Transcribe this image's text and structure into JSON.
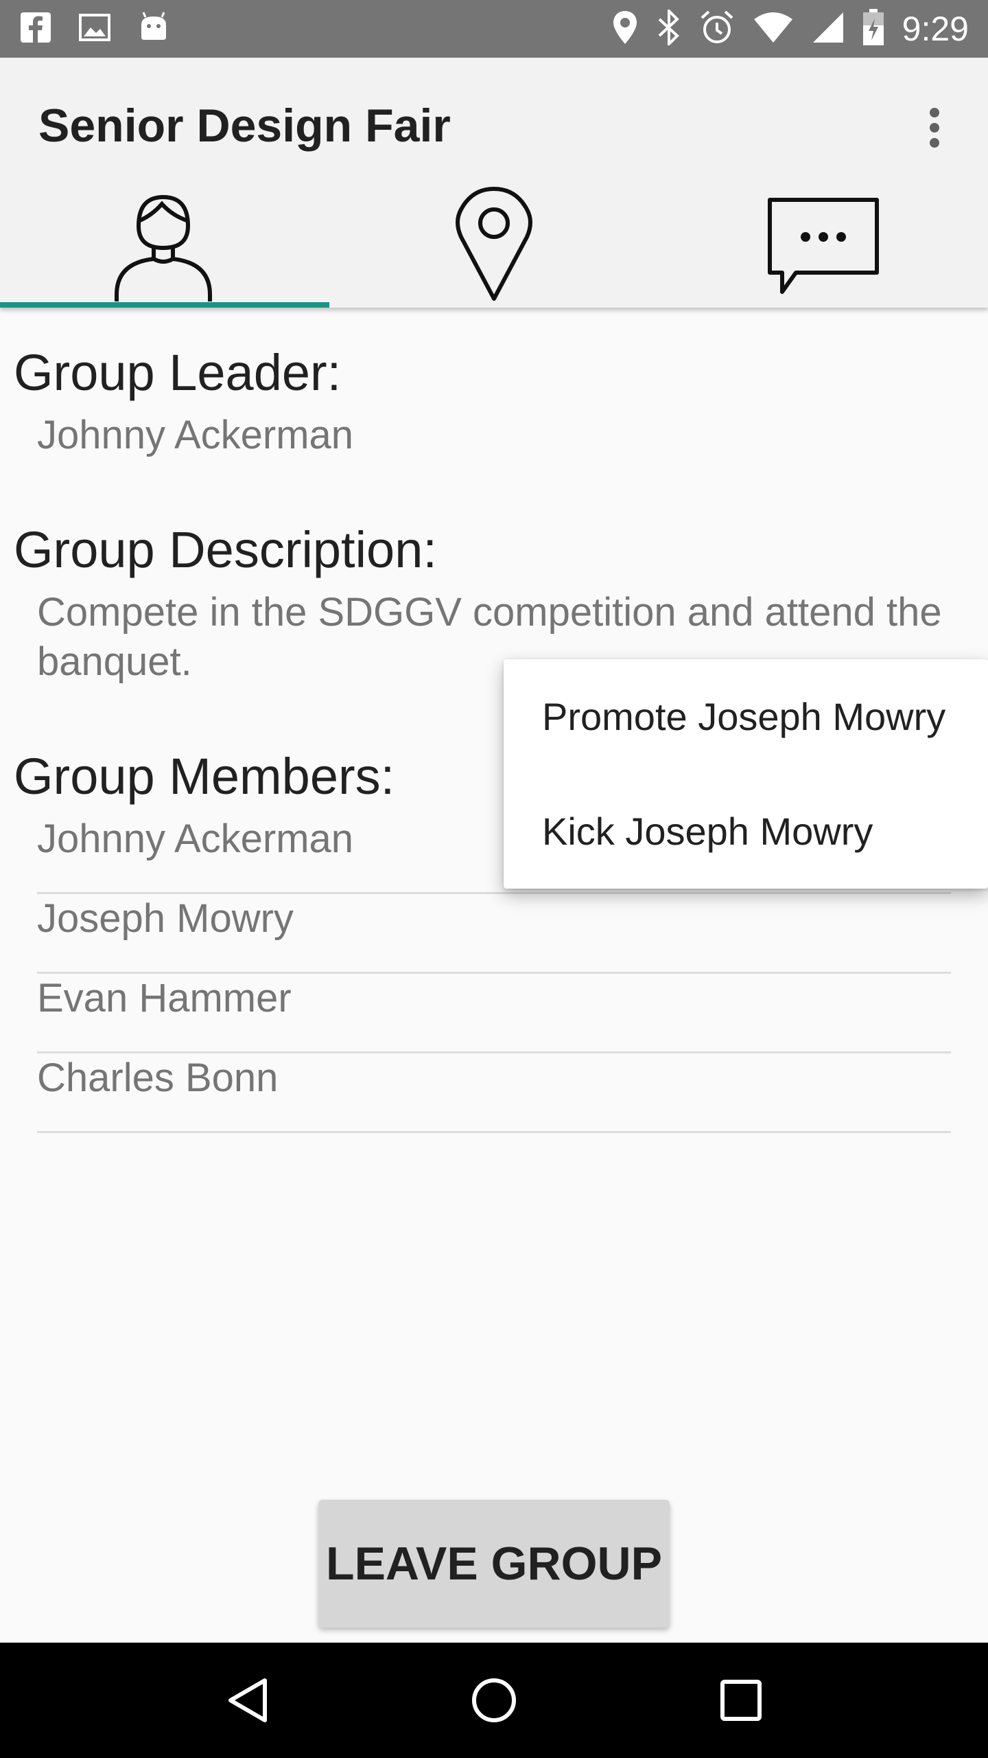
{
  "status_bar": {
    "time": "9:29",
    "left_icons": [
      "facebook-icon",
      "image-icon",
      "android-icon"
    ],
    "right_icons": [
      "location-icon",
      "bluetooth-icon",
      "alarm-icon",
      "wifi-icon",
      "signal-icon",
      "battery-icon"
    ]
  },
  "app_bar": {
    "title": "Senior Design Fair",
    "overflow_icon": "more-vert-icon",
    "tabs": [
      {
        "icon": "person-icon",
        "selected": true
      },
      {
        "icon": "location-pin-icon",
        "selected": false
      },
      {
        "icon": "chat-icon",
        "selected": false
      }
    ]
  },
  "leader": {
    "heading": "Group Leader:",
    "name": "Johnny Ackerman"
  },
  "description": {
    "heading": "Group Description:",
    "text": "Compete in the SDGGV competition and attend the banquet."
  },
  "members": {
    "heading": "Group Members:",
    "items": [
      "Johnny Ackerman",
      "Joseph Mowry",
      "Evan Hammer",
      "Charles Bonn"
    ]
  },
  "popup_menu": {
    "items": [
      "Promote Joseph Mowry",
      "Kick Joseph Mowry"
    ]
  },
  "leave_button": {
    "label": "LEAVE GROUP"
  },
  "nav_bar": {
    "icons": [
      "back-icon",
      "home-icon",
      "recents-icon"
    ]
  },
  "colors": {
    "accent": "#1a9485",
    "status_bar": "#757575",
    "app_bar": "#f2f2f2",
    "background": "#fafafa"
  }
}
